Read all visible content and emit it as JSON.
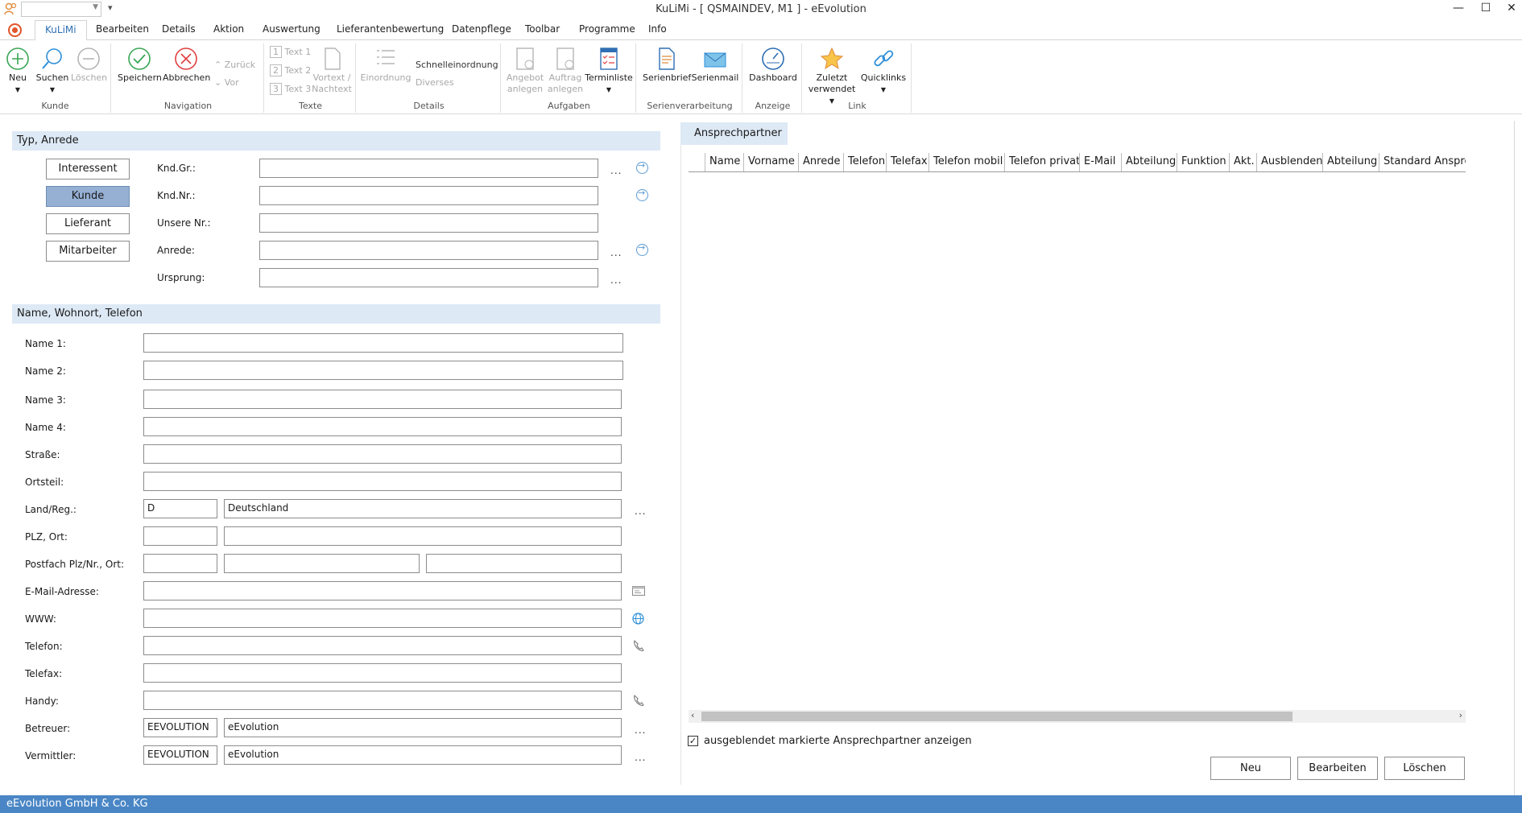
{
  "window": {
    "title": "KuLiMi - [ QSMAINDEV, M1 ]  -  eEvolution",
    "minimize": "—",
    "maximize": "☐",
    "close": "✕"
  },
  "ribbon_tabs": [
    "KuLiMi",
    "Bearbeiten",
    "Details",
    "Aktion",
    "Auswertung",
    "Lieferantenbewertung",
    "Datenpflege",
    "Toolbar",
    "Programme",
    "Info"
  ],
  "ribbon": {
    "kunde": {
      "label": "Kunde",
      "neu": "Neu",
      "suchen": "Suchen",
      "loeschen": "Löschen"
    },
    "navigation": {
      "label": "Navigation",
      "speichern": "Speichern",
      "abbrechen": "Abbrechen",
      "zurueck": "Zurück",
      "vor": "Vor"
    },
    "texte": {
      "label": "Texte",
      "text1": "Text 1",
      "text2": "Text 2",
      "text3": "Text 3",
      "vortext_1": "Vortext /",
      "vortext_2": "Nachtext"
    },
    "details": {
      "label": "Details",
      "einordnung": "Einordnung",
      "schnelleinordnung": "Schnelleinordnung",
      "diverses": "Diverses"
    },
    "aufgaben": {
      "label": "Aufgaben",
      "angebot_1": "Angebot",
      "angebot_2": "anlegen",
      "auftrag_1": "Auftrag",
      "auftrag_2": "anlegen",
      "terminliste": "Terminliste"
    },
    "serienverarbeitung": {
      "label": "Serienverarbeitung",
      "serienbrief": "Serienbrief",
      "serienmail": "Serienmail"
    },
    "anzeige": {
      "label": "Anzeige",
      "dashboard": "Dashboard"
    },
    "link": {
      "label": "Link",
      "zuletzt_1": "Zuletzt",
      "zuletzt_2": "verwendet",
      "quicklinks": "Quicklinks"
    }
  },
  "typ_anrede": {
    "header": "Typ, Anrede",
    "types": [
      "Interessent",
      "Kunde",
      "Lieferant",
      "Mitarbeiter"
    ],
    "selected_type": "Kunde",
    "labels": [
      "Knd.Gr.:",
      "Knd.Nr.:",
      "Unsere Nr.:",
      "Anrede:",
      "Ursprung:"
    ],
    "dots": "..."
  },
  "name_section": {
    "header": "Name, Wohnort, Telefon",
    "labels": {
      "name1": "Name 1:",
      "name2": "Name 2:",
      "name3": "Name 3:",
      "name4": "Name 4:",
      "strasse": "Straße:",
      "ortsteil": "Ortsteil:",
      "land": "Land/Reg.:",
      "plz": "PLZ, Ort:",
      "postfach": "Postfach Plz/Nr., Ort:",
      "email": "E-Mail-Adresse:",
      "www": "WWW:",
      "telefon": "Telefon:",
      "telefax": "Telefax:",
      "handy": "Handy:",
      "betreuer": "Betreuer:",
      "vermittler": "Vermittler:"
    },
    "values": {
      "land_code": "D",
      "land_name": "Deutschland",
      "betreuer_code": "EEVOLUTION",
      "betreuer_name": "eEvolution",
      "vermittler_code": "EEVOLUTION",
      "vermittler_name": "eEvolution"
    }
  },
  "ansprechpartner": {
    "tab": "Ansprechpartner",
    "columns": [
      "Name",
      "Vorname",
      "Anrede",
      "Telefon",
      "Telefax",
      "Telefon mobil",
      "Telefon privat",
      "E-Mail",
      "Abteilung",
      "Funktion",
      "Akt.",
      "Ausblenden",
      "Abteilung",
      "Standard Ansprec"
    ],
    "show_hidden_label": "ausgeblendet markierte Ansprechpartner anzeigen",
    "show_hidden_checked": true,
    "buttons": {
      "neu": "Neu",
      "bearbeiten": "Bearbeiten",
      "loeschen": "Löschen"
    }
  },
  "status_bar": "eEvolution GmbH & Co. KG"
}
